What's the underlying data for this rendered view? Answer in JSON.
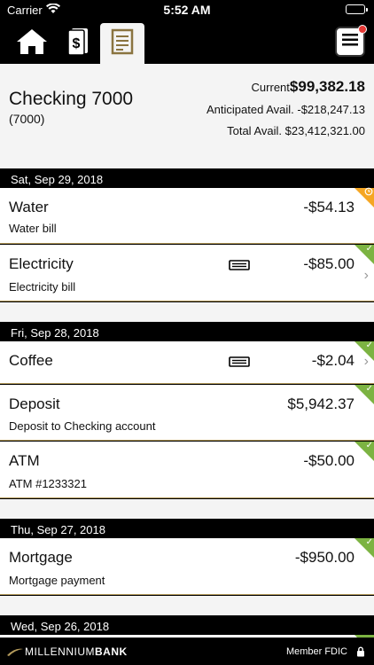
{
  "status": {
    "carrier": "Carrier",
    "time": "5:52 AM"
  },
  "account": {
    "name": "Checking 7000",
    "number": "(7000)",
    "current_label": "Current",
    "current_value": "$99,382.18",
    "anticipated": "Anticipated Avail. -$218,247.13",
    "total": "Total Avail. $23,412,321.00"
  },
  "dates": [
    "Sat, Sep 29, 2018",
    "Fri, Sep 28, 2018",
    "Thu, Sep 27, 2018",
    "Wed, Sep 26, 2018"
  ],
  "transactions": [
    {
      "title": "Water",
      "amount": "-$54.13",
      "desc": "Water bill"
    },
    {
      "title": "Electricity",
      "amount": "-$85.00",
      "desc": "Electricity bill"
    },
    {
      "title": "Coffee",
      "amount": "-$2.04"
    },
    {
      "title": "Deposit",
      "amount": "$5,942.37",
      "desc": "Deposit to Checking account"
    },
    {
      "title": "ATM",
      "amount": "-$50.00",
      "desc": "ATM #1233321"
    },
    {
      "title": "Mortgage",
      "amount": "-$950.00",
      "desc": "Mortgage payment"
    }
  ],
  "footer": {
    "brand_a": "MILLENNIUM",
    "brand_b": "BANK",
    "fdic": "Member FDIC"
  },
  "colors": {
    "accent": "#b49b5c",
    "cleared": "#7cb342",
    "pending": "#f5a623",
    "alert": "#e53935"
  },
  "icons": [
    "wifi-icon",
    "battery-icon",
    "home-icon",
    "money-icon",
    "register-icon",
    "menu-icon",
    "card-icon",
    "chevron-right-icon",
    "check-icon",
    "clock-icon",
    "lock-icon"
  ]
}
